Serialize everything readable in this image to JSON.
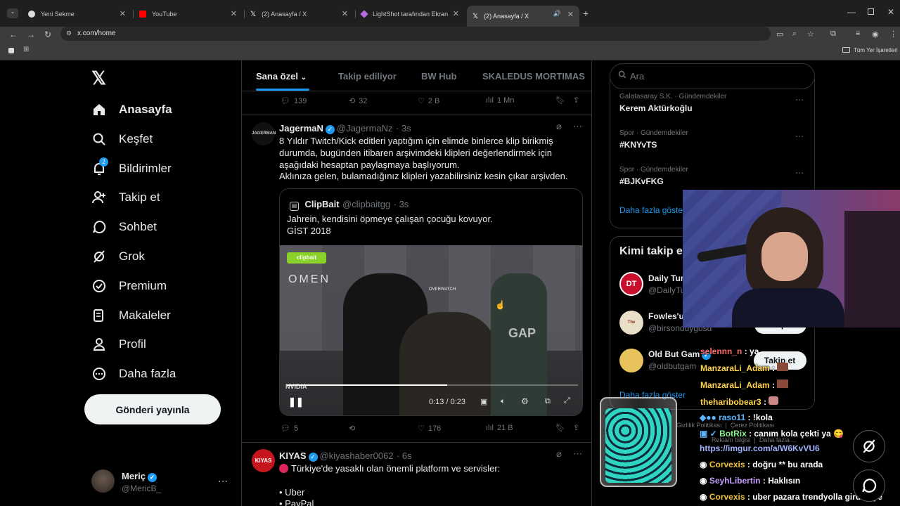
{
  "browser": {
    "tabs": [
      {
        "title": "Yeni Sekme"
      },
      {
        "title": "YouTube"
      },
      {
        "title": "(2) Anasayfa / X"
      },
      {
        "title": "LightShot tarafından Ekran Gör..."
      },
      {
        "title": "(2) Anasayfa / X"
      }
    ],
    "url": "x.com/home",
    "bookmarks_label": "Tüm Yer İşaretleri"
  },
  "nav": {
    "items": [
      {
        "label": "Anasayfa",
        "icon": "home-icon"
      },
      {
        "label": "Keşfet",
        "icon": "search-icon"
      },
      {
        "label": "Bildirimler",
        "icon": "bell-icon",
        "badge": "2"
      },
      {
        "label": "Takip et",
        "icon": "follow-icon"
      },
      {
        "label": "Sohbet",
        "icon": "chat-icon"
      },
      {
        "label": "Grok",
        "icon": "grok-icon"
      },
      {
        "label": "Premium",
        "icon": "premium-icon"
      },
      {
        "label": "Makaleler",
        "icon": "articles-icon"
      },
      {
        "label": "Profil",
        "icon": "profile-icon"
      },
      {
        "label": "Daha fazla",
        "icon": "more-icon"
      }
    ],
    "post_button": "Gönderi yayınla",
    "user": {
      "name": "Meriç",
      "handle": "@MericB_"
    }
  },
  "feed": {
    "tabs": [
      "Sana özel",
      "Takip ediliyor",
      "BW Hub",
      "SKALEDUS MORTIMAS"
    ],
    "prev_actions": {
      "replies": "139",
      "reposts": "32",
      "likes": "2 B",
      "views": "1 Mn"
    },
    "tweet1": {
      "avatar_text": "JAGERMAN",
      "name": "JagermaN",
      "handle": "@JagermaNz",
      "time": "· 3s",
      "text1": "8 Yıldır Twitch/Kick editleri yaptığım için elimde binlerce klip birikmiş durumda, bugünden itibaren arşivimdeki klipleri değerlendirmek için aşağıdaki hesaptan paylaşmaya başlıyorum.",
      "text2": "Aklınıza gelen, bulamadığınız klipleri yazabilirsiniz kesin çıkar arşivden.",
      "quote": {
        "name": "ClipBait",
        "handle": "@clipbaitgg",
        "time": "· 3s",
        "text1": "Jahrein, kendisini öpmeye çalışan çocuğu kovuyor.",
        "text2": "GİST 2018",
        "video_time": "0:13 / 0:23",
        "wall_logos": [
          "OMEN",
          "OVERWATCH",
          "NVIDIA",
          "GAP"
        ]
      },
      "actions": {
        "replies": "5",
        "reposts": "",
        "likes": "176",
        "views": "21 B"
      }
    },
    "tweet2": {
      "avatar_text": "KIYAS",
      "name": "KIYAS",
      "handle": "@kiyashaber0062",
      "time": "· 6s",
      "text": "Türkiye'de yasaklı olan önemli platform ve servisler:",
      "list": [
        "• Uber",
        "• PayPal"
      ]
    }
  },
  "right": {
    "search_placeholder": "Ara",
    "trends": [
      {
        "meta": "Galatasaray S.K. · Gündemdekiler",
        "name": "Kerem Aktürkoğlu"
      },
      {
        "meta": "Spor · Gündemdekiler",
        "name": "#KNYvTS"
      },
      {
        "meta": "Spor · Gündemdekiler",
        "name": "#BJKvFKG"
      }
    ],
    "show_more": "Daha fazla göster",
    "who_to_follow_title": "Kimi takip e",
    "suggestions": [
      {
        "name": "Daily Tur",
        "handle": "@DailyTu",
        "avatar": "DT"
      },
      {
        "name": "Fowles'u",
        "handle": "@birsonduygusu",
        "avatar": "The Collector"
      },
      {
        "name": "Old But Gam",
        "handle": "@oldbutgam",
        "avatar": ""
      }
    ],
    "follow_label": "Takip et",
    "show_more2": "Daha fazla göster",
    "footer": [
      "Gizlilik Politikası",
      "Çerez Politikası",
      "Reklam bilgisi",
      "Daha fazla ..."
    ]
  },
  "chat": [
    {
      "user": "selennn_n",
      "msg": "ya"
    },
    {
      "user": "ManzaraLi_Adam",
      "msg": ""
    },
    {
      "user": "ManzaraLi_Adam",
      "msg": ""
    },
    {
      "user": "theharibobear3",
      "msg": ""
    },
    {
      "user": "raso11",
      "msg": "!kola"
    },
    {
      "user": "BotRix",
      "msg": "canım kola çekti ya 😋"
    },
    {
      "user": "",
      "msg": "https://imgur.com/a/W6KvVU6"
    },
    {
      "user": "Corvexis",
      "msg": "doğru ** bu arada"
    },
    {
      "user": "SeyhLibertin",
      "msg": "Haklısın"
    },
    {
      "user": "Corvexis",
      "msg": "uber pazara trendyolla girdi diye"
    }
  ],
  "colors": {
    "accent": "#1d9bf0",
    "bg": "#000000",
    "muted": "#71767b"
  }
}
